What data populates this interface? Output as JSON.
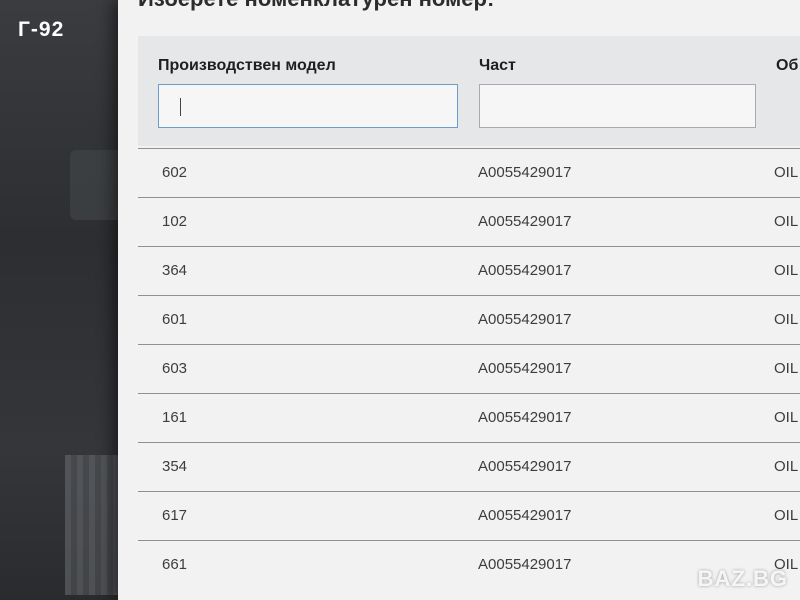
{
  "watermark": {
    "label": "Г-92",
    "logo": "BAZ.BG"
  },
  "page": {
    "title": "Изберете номенклатурен номер:"
  },
  "filters": {
    "columns": [
      {
        "header": "Производствен модел",
        "value": "",
        "placeholder": ""
      },
      {
        "header": "Част",
        "value": "",
        "placeholder": ""
      },
      {
        "header": "Об"
      }
    ]
  },
  "table": {
    "rows": [
      {
        "model": "602",
        "part": "A0055429017",
        "desc": "OIL"
      },
      {
        "model": "102",
        "part": "A0055429017",
        "desc": "OIL"
      },
      {
        "model": "364",
        "part": "A0055429017",
        "desc": "OIL"
      },
      {
        "model": "601",
        "part": "A0055429017",
        "desc": "OIL"
      },
      {
        "model": "603",
        "part": "A0055429017",
        "desc": "OIL"
      },
      {
        "model": "161",
        "part": "A0055429017",
        "desc": "OIL P"
      },
      {
        "model": "354",
        "part": "A0055429017",
        "desc": "OIL P"
      },
      {
        "model": "617",
        "part": "A0055429017",
        "desc": "OIL P"
      },
      {
        "model": "661",
        "part": "A0055429017",
        "desc": "OIL P"
      }
    ]
  },
  "colors": {
    "screen_bg": "#f1f2f1",
    "panel_bg": "#e5e7e8",
    "active_input_border": "#6d9cc8"
  }
}
